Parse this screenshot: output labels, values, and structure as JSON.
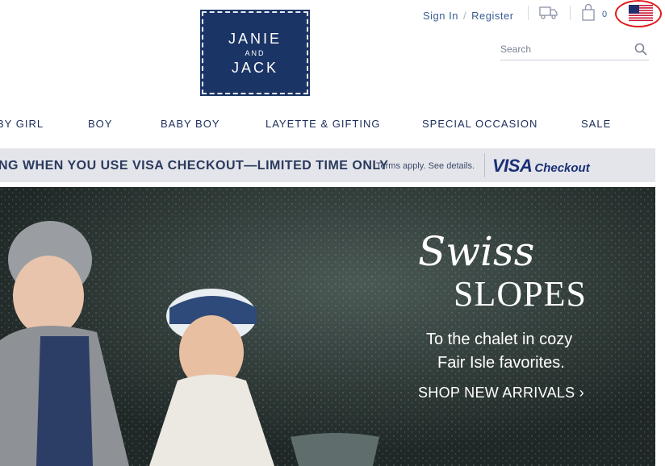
{
  "header": {
    "logo": {
      "line1": "JANIE",
      "line2": "AND",
      "line3": "JACK"
    },
    "sign_in": "Sign In",
    "separator": "/",
    "register": "Register",
    "bag_count": "0",
    "search_placeholder": "Search",
    "icons": [
      "truck-icon",
      "shopping-bag-icon",
      "us-flag-icon",
      "search-icon"
    ],
    "highlight_color": "#e11a1a"
  },
  "nav": {
    "items": [
      "BY GIRL",
      "BOY",
      "BABY BOY",
      "LAYETTE & GIFTING",
      "SPECIAL OCCASION",
      "SALE"
    ]
  },
  "promo": {
    "main_text": "NG WHEN YOU USE VISA CHECKOUT—LIMITED TIME ONLY",
    "terms": "Terms apply. See details.",
    "brand": "VISA",
    "brand_suffix": "Checkout"
  },
  "hero": {
    "script_title": "Swiss",
    "title": "SLOPES",
    "subtitle_line1": "To the chalet in cozy",
    "subtitle_line2": "Fair Isle favorites.",
    "cta": "SHOP NEW ARRIVALS ›"
  },
  "colors": {
    "brand_navy": "#1b3466",
    "text_navy": "#1b2d5a",
    "promo_bg": "#e3e5ea"
  }
}
